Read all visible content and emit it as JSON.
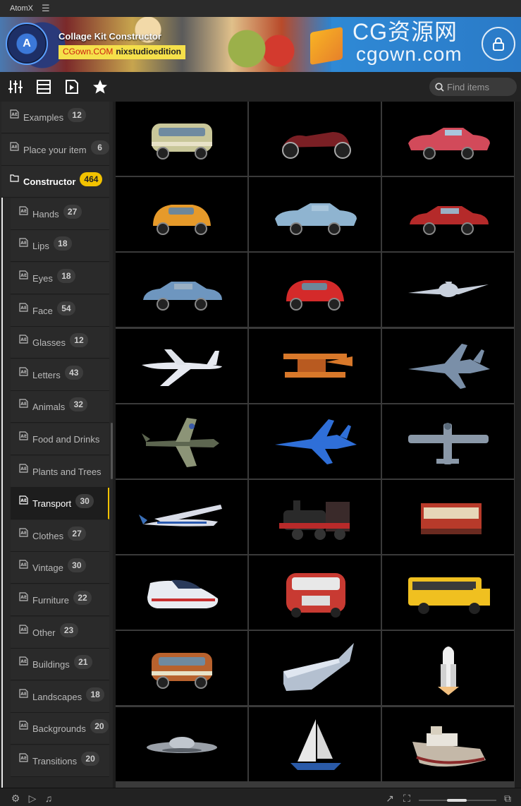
{
  "app": {
    "title": "AtomX",
    "menu_icon": "hamburger-icon"
  },
  "banner": {
    "title": "Collage Kit Constructor",
    "tag_left": "CGown.COM",
    "tag_right": "nixstudioedition",
    "logo_letter": "A",
    "watermark_cn": "CG资源网",
    "watermark_url": "cgown.com",
    "lock_icon": "lock-icon"
  },
  "toolbar": {
    "icons": [
      "sliders-icon",
      "list-icon",
      "play-file-icon",
      "star-icon"
    ],
    "search_placeholder": "Find items"
  },
  "sidebar": {
    "top_items": [
      {
        "label": "Examples",
        "count": "12"
      },
      {
        "label": "Place your item",
        "count": "6"
      }
    ],
    "group": {
      "label": "Constructor",
      "count": "464"
    },
    "sub_items": [
      {
        "label": "Hands",
        "count": "27"
      },
      {
        "label": "Lips",
        "count": "18"
      },
      {
        "label": "Eyes",
        "count": "18"
      },
      {
        "label": "Face",
        "count": "54"
      },
      {
        "label": "Glasses",
        "count": "12"
      },
      {
        "label": "Letters",
        "count": "43"
      },
      {
        "label": "Animals",
        "count": "32"
      },
      {
        "label": "Food and Drinks",
        "count": ""
      },
      {
        "label": "Plants and Trees",
        "count": ""
      },
      {
        "label": "Transport",
        "count": "30",
        "selected": true
      },
      {
        "label": "Clothes",
        "count": "27"
      },
      {
        "label": "Vintage",
        "count": "30"
      },
      {
        "label": "Furniture",
        "count": "22"
      },
      {
        "label": "Other",
        "count": "23"
      },
      {
        "label": "Buildings",
        "count": "21"
      },
      {
        "label": "Landscapes",
        "count": "18"
      },
      {
        "label": "Backgrounds",
        "count": "20"
      },
      {
        "label": "Transitions",
        "count": "20"
      }
    ]
  },
  "grid": {
    "items": [
      {
        "name": "vw-van-cream",
        "kind": "van",
        "color": "#c9c79a"
      },
      {
        "name": "vintage-roadster",
        "kind": "roadster",
        "color": "#7a1f24"
      },
      {
        "name": "pink-cadillac",
        "kind": "longcar",
        "color": "#d24a5a"
      },
      {
        "name": "orange-fiat",
        "kind": "smallcar",
        "color": "#e69a2a"
      },
      {
        "name": "blue-classic-car",
        "kind": "longcar",
        "color": "#8fb4d0"
      },
      {
        "name": "red-mustang",
        "kind": "car",
        "color": "#b52a2a"
      },
      {
        "name": "blue-coupe",
        "kind": "car",
        "color": "#6e96bf"
      },
      {
        "name": "red-fiat",
        "kind": "smallcar",
        "color": "#d42a2a"
      },
      {
        "name": "airliner-front",
        "kind": "jetfront",
        "color": "#c8d0dc"
      },
      {
        "name": "white-airliner",
        "kind": "airliner",
        "color": "#e6e9f0"
      },
      {
        "name": "orange-biplane",
        "kind": "biplane",
        "color": "#d8782a"
      },
      {
        "name": "grey-fighter-jet",
        "kind": "fighter",
        "color": "#7a8fa8"
      },
      {
        "name": "spitfire",
        "kind": "prop",
        "color": "#5d6650"
      },
      {
        "name": "blue-fighter-jet",
        "kind": "fighter",
        "color": "#2f6fd8"
      },
      {
        "name": "grey-prop-plane",
        "kind": "topplane",
        "color": "#8a98a8"
      },
      {
        "name": "cessna",
        "kind": "cessna",
        "color": "#d9dde8"
      },
      {
        "name": "steam-locomotive",
        "kind": "train",
        "color": "#2a2a2a"
      },
      {
        "name": "tram",
        "kind": "tram",
        "color": "#b83a2a"
      },
      {
        "name": "high-speed-train",
        "kind": "bullet",
        "color": "#e8ecf2"
      },
      {
        "name": "red-bus",
        "kind": "bus",
        "color": "#c83a32"
      },
      {
        "name": "school-bus",
        "kind": "schoolbus",
        "color": "#f0c020"
      },
      {
        "name": "rusty-vw-van",
        "kind": "van",
        "color": "#b8622e"
      },
      {
        "name": "aircraft-wing",
        "kind": "wing",
        "color": "#b4c0d0"
      },
      {
        "name": "space-shuttle",
        "kind": "shuttle",
        "color": "#eeeeee"
      },
      {
        "name": "flying-saucer",
        "kind": "ufo",
        "color": "#9aa0a8"
      },
      {
        "name": "sailboat",
        "kind": "sail",
        "color": "#e8e8e8"
      },
      {
        "name": "old-boat",
        "kind": "boat",
        "color": "#c4b8a8"
      }
    ]
  },
  "bottombar": {
    "icons": [
      "settings-icon",
      "play-icon",
      "music-icon",
      "expand-icon",
      "fullscreen-icon",
      "window-icon"
    ]
  }
}
